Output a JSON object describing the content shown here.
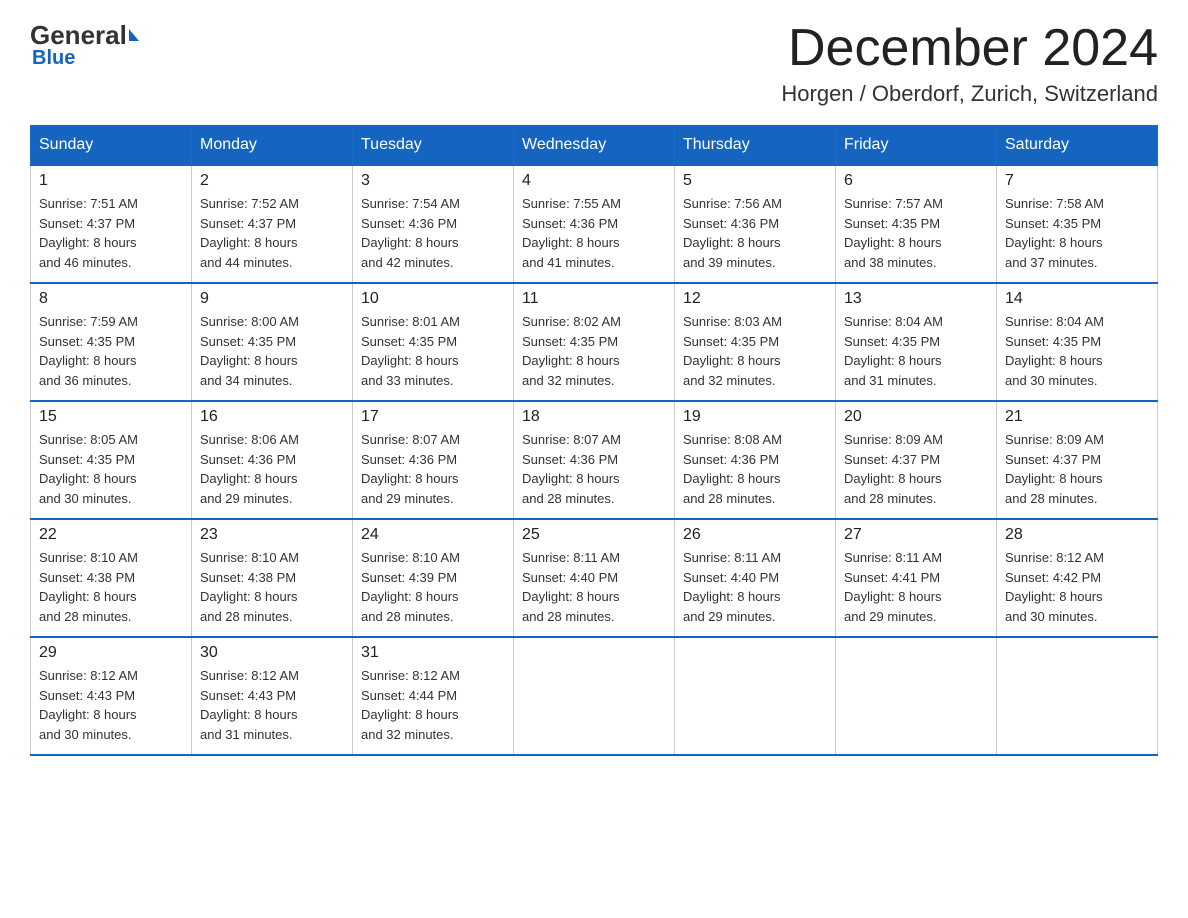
{
  "header": {
    "title": "December 2024",
    "location": "Horgen / Oberdorf, Zurich, Switzerland",
    "logo_general": "General",
    "logo_blue": "Blue"
  },
  "weekdays": [
    "Sunday",
    "Monday",
    "Tuesday",
    "Wednesday",
    "Thursday",
    "Friday",
    "Saturday"
  ],
  "weeks": [
    [
      {
        "day": "1",
        "sunrise": "7:51 AM",
        "sunset": "4:37 PM",
        "daylight": "8 hours and 46 minutes."
      },
      {
        "day": "2",
        "sunrise": "7:52 AM",
        "sunset": "4:37 PM",
        "daylight": "8 hours and 44 minutes."
      },
      {
        "day": "3",
        "sunrise": "7:54 AM",
        "sunset": "4:36 PM",
        "daylight": "8 hours and 42 minutes."
      },
      {
        "day": "4",
        "sunrise": "7:55 AM",
        "sunset": "4:36 PM",
        "daylight": "8 hours and 41 minutes."
      },
      {
        "day": "5",
        "sunrise": "7:56 AM",
        "sunset": "4:36 PM",
        "daylight": "8 hours and 39 minutes."
      },
      {
        "day": "6",
        "sunrise": "7:57 AM",
        "sunset": "4:35 PM",
        "daylight": "8 hours and 38 minutes."
      },
      {
        "day": "7",
        "sunrise": "7:58 AM",
        "sunset": "4:35 PM",
        "daylight": "8 hours and 37 minutes."
      }
    ],
    [
      {
        "day": "8",
        "sunrise": "7:59 AM",
        "sunset": "4:35 PM",
        "daylight": "8 hours and 36 minutes."
      },
      {
        "day": "9",
        "sunrise": "8:00 AM",
        "sunset": "4:35 PM",
        "daylight": "8 hours and 34 minutes."
      },
      {
        "day": "10",
        "sunrise": "8:01 AM",
        "sunset": "4:35 PM",
        "daylight": "8 hours and 33 minutes."
      },
      {
        "day": "11",
        "sunrise": "8:02 AM",
        "sunset": "4:35 PM",
        "daylight": "8 hours and 32 minutes."
      },
      {
        "day": "12",
        "sunrise": "8:03 AM",
        "sunset": "4:35 PM",
        "daylight": "8 hours and 32 minutes."
      },
      {
        "day": "13",
        "sunrise": "8:04 AM",
        "sunset": "4:35 PM",
        "daylight": "8 hours and 31 minutes."
      },
      {
        "day": "14",
        "sunrise": "8:04 AM",
        "sunset": "4:35 PM",
        "daylight": "8 hours and 30 minutes."
      }
    ],
    [
      {
        "day": "15",
        "sunrise": "8:05 AM",
        "sunset": "4:35 PM",
        "daylight": "8 hours and 30 minutes."
      },
      {
        "day": "16",
        "sunrise": "8:06 AM",
        "sunset": "4:36 PM",
        "daylight": "8 hours and 29 minutes."
      },
      {
        "day": "17",
        "sunrise": "8:07 AM",
        "sunset": "4:36 PM",
        "daylight": "8 hours and 29 minutes."
      },
      {
        "day": "18",
        "sunrise": "8:07 AM",
        "sunset": "4:36 PM",
        "daylight": "8 hours and 28 minutes."
      },
      {
        "day": "19",
        "sunrise": "8:08 AM",
        "sunset": "4:36 PM",
        "daylight": "8 hours and 28 minutes."
      },
      {
        "day": "20",
        "sunrise": "8:09 AM",
        "sunset": "4:37 PM",
        "daylight": "8 hours and 28 minutes."
      },
      {
        "day": "21",
        "sunrise": "8:09 AM",
        "sunset": "4:37 PM",
        "daylight": "8 hours and 28 minutes."
      }
    ],
    [
      {
        "day": "22",
        "sunrise": "8:10 AM",
        "sunset": "4:38 PM",
        "daylight": "8 hours and 28 minutes."
      },
      {
        "day": "23",
        "sunrise": "8:10 AM",
        "sunset": "4:38 PM",
        "daylight": "8 hours and 28 minutes."
      },
      {
        "day": "24",
        "sunrise": "8:10 AM",
        "sunset": "4:39 PM",
        "daylight": "8 hours and 28 minutes."
      },
      {
        "day": "25",
        "sunrise": "8:11 AM",
        "sunset": "4:40 PM",
        "daylight": "8 hours and 28 minutes."
      },
      {
        "day": "26",
        "sunrise": "8:11 AM",
        "sunset": "4:40 PM",
        "daylight": "8 hours and 29 minutes."
      },
      {
        "day": "27",
        "sunrise": "8:11 AM",
        "sunset": "4:41 PM",
        "daylight": "8 hours and 29 minutes."
      },
      {
        "day": "28",
        "sunrise": "8:12 AM",
        "sunset": "4:42 PM",
        "daylight": "8 hours and 30 minutes."
      }
    ],
    [
      {
        "day": "29",
        "sunrise": "8:12 AM",
        "sunset": "4:43 PM",
        "daylight": "8 hours and 30 minutes."
      },
      {
        "day": "30",
        "sunrise": "8:12 AM",
        "sunset": "4:43 PM",
        "daylight": "8 hours and 31 minutes."
      },
      {
        "day": "31",
        "sunrise": "8:12 AM",
        "sunset": "4:44 PM",
        "daylight": "8 hours and 32 minutes."
      },
      null,
      null,
      null,
      null
    ]
  ],
  "labels": {
    "sunrise_prefix": "Sunrise: ",
    "sunset_prefix": "Sunset: ",
    "daylight_prefix": "Daylight: "
  }
}
